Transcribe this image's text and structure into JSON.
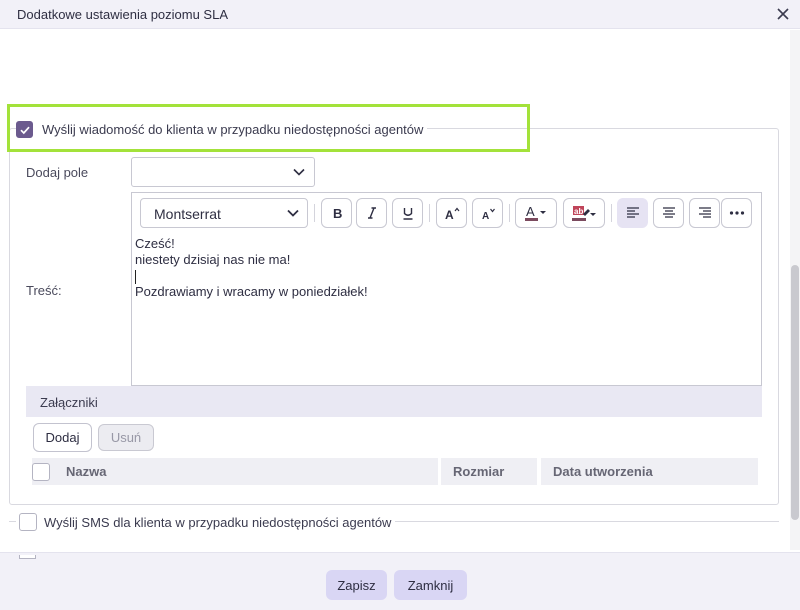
{
  "dialog": {
    "title": "Dodatkowe ustawienia poziomu SLA",
    "close_icon": "close-icon"
  },
  "message_section": {
    "enabled": true,
    "label": "Wyślij wiadomość do klienta w przypadku niedostępności agentów",
    "add_field_label": "Dodaj pole",
    "add_field_value": "",
    "content_label": "Treść:",
    "editor": {
      "font": "Montserrat",
      "buttons": [
        "bold-icon",
        "italic-icon",
        "underline-icon",
        "increase-font-icon",
        "decrease-font-icon",
        "text-color-icon",
        "highlight-color-icon",
        "align-left-icon",
        "align-center-icon",
        "align-right-icon",
        "more-icon"
      ],
      "active_alignment": "left",
      "lines": [
        "Cześć!",
        "niestety dzisiaj nas nie ma!",
        "",
        "Pozdrawiamy i wracamy w poniedziałek!"
      ]
    },
    "attachments": {
      "title": "Załączniki",
      "add_label": "Dodaj",
      "remove_label": "Usuń",
      "columns": [
        "Nazwa",
        "Rozmiar",
        "Data utworzenia"
      ]
    }
  },
  "sms_section": {
    "enabled": false,
    "label": "Wyślij SMS dla klienta w przypadku niedostępności agentów"
  },
  "footer": {
    "save_label": "Zapisz",
    "close_label": "Zamknij"
  },
  "colors": {
    "accent": "#6b5a8e",
    "highlight_border": "#a3e23a",
    "button_primary": "#d9d6f4"
  }
}
